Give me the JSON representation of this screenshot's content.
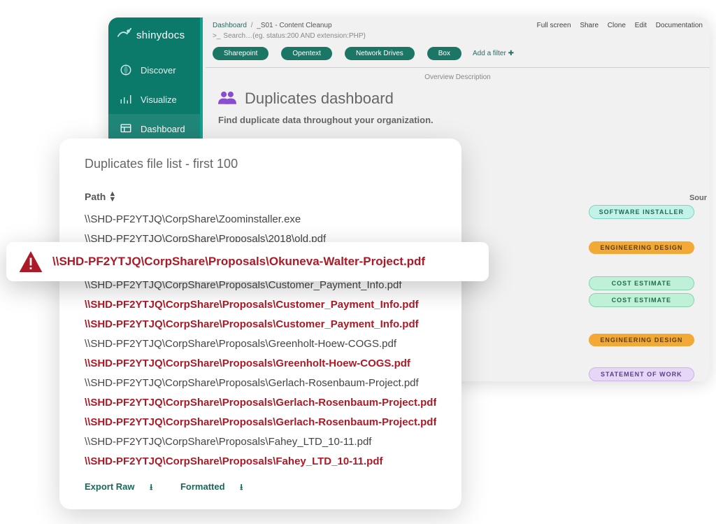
{
  "brand": "shinydocs",
  "nav": [
    {
      "label": "Discover"
    },
    {
      "label": "Visualize"
    },
    {
      "label": "Dashboard"
    }
  ],
  "breadcrumb": {
    "root": "Dashboard",
    "current": "_S01 - Content Cleanup"
  },
  "topbar": {
    "full_screen": "Full screen",
    "share": "Share",
    "clone": "Clone",
    "edit": "Edit",
    "docs": "Documentation"
  },
  "search": {
    "prefix": ">_",
    "placeholder": "Search…(eg. status:200 AND extension:PHP)"
  },
  "filters": {
    "pills": [
      "Sharepoint",
      "Opentext",
      "Network Drives",
      "Box"
    ],
    "add": "Add a filter"
  },
  "overview_label": "Overview Description",
  "page": {
    "title": "Duplicates dashboard",
    "subtitle": "Find duplicate data throughout your organization."
  },
  "sour_label": "Sour",
  "tags": [
    {
      "text": "SOFTWARE INSTALLER",
      "style": "teal",
      "gapAfter": 32
    },
    {
      "text": "ENGINEERING DESIGN",
      "style": "orange",
      "gapAfter": 32
    },
    {
      "text": "COST ESTIMATE",
      "style": "mint",
      "gapAfter": 4
    },
    {
      "text": "COST ESTIMATE",
      "style": "mint",
      "gapAfter": 38
    },
    {
      "text": "ENGINEERING DESIGN",
      "style": "orange",
      "gapAfter": 30
    },
    {
      "text": "STATEMENT OF WORK",
      "style": "purp",
      "gapAfter": 0
    }
  ],
  "list": {
    "title": "Duplicates file list - first 100",
    "header": "Path",
    "rows": [
      {
        "path": "\\\\SHD-PF2YTJQ\\CorpShare\\Zoominstaller.exe",
        "dup": false
      },
      {
        "path": "\\\\SHD-PF2YTJQ\\CorpShare\\Proposals\\2018\\old.pdf",
        "dup": false
      },
      {
        "gap": true
      },
      {
        "path": "\\\\SHD-PF2YTJQ\\CorpShare\\Proposals\\Customer_Payment_Info.pdf",
        "dup": false
      },
      {
        "path": "\\\\SHD-PF2YTJQ\\CorpShare\\Proposals\\Customer_Payment_Info.pdf",
        "dup": true
      },
      {
        "path": "\\\\SHD-PF2YTJQ\\CorpShare\\Proposals\\Customer_Payment_Info.pdf",
        "dup": true
      },
      {
        "path": "\\\\SHD-PF2YTJQ\\CorpShare\\Proposals\\Greenholt-Hoew-COGS.pdf",
        "dup": false
      },
      {
        "path": "\\\\SHD-PF2YTJQ\\CorpShare\\Proposals\\Greenholt-Hoew-COGS.pdf",
        "dup": true
      },
      {
        "path": "\\\\SHD-PF2YTJQ\\CorpShare\\Proposals\\Gerlach-Rosenbaum-Project.pdf",
        "dup": false
      },
      {
        "path": "\\\\SHD-PF2YTJQ\\CorpShare\\Proposals\\Gerlach-Rosenbaum-Project.pdf",
        "dup": true
      },
      {
        "path": "\\\\SHD-PF2YTJQ\\CorpShare\\Proposals\\Gerlach-Rosenbaum-Project.pdf",
        "dup": true
      },
      {
        "path": "\\\\SHD-PF2YTJQ\\CorpShare\\Proposals\\Fahey_LTD_10-11.pdf",
        "dup": false
      },
      {
        "path": "\\\\SHD-PF2YTJQ\\CorpShare\\Proposals\\Fahey_LTD_10-11.pdf",
        "dup": true
      }
    ],
    "export_raw": "Export Raw",
    "export_fmt": "Formatted"
  },
  "alert": {
    "path": "\\\\SHD-PF2YTJQ\\CorpShare\\Proposals\\Okuneva-Walter-Project.pdf"
  }
}
